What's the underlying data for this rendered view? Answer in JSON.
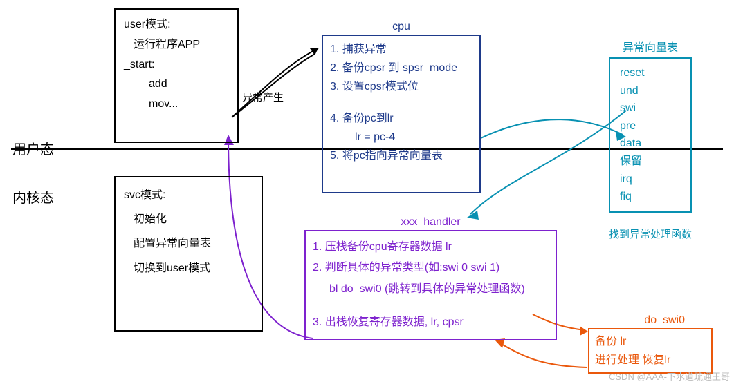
{
  "labels": {
    "user_state": "用户态",
    "kernel_state": "内核态",
    "exception_gen": "异常产生"
  },
  "user_box": {
    "l1": "user模式:",
    "l2": "运行程序APP",
    "l3": "_start:",
    "l4": "add",
    "l5": "mov..."
  },
  "svc_box": {
    "l1": "svc模式:",
    "l2": "初始化",
    "l3": "配置异常向量表",
    "l4": "切换到user模式"
  },
  "cpu_box": {
    "title": "cpu",
    "l1": "1. 捕获异常",
    "l2": "2. 备份cpsr 到 spsr_mode",
    "l3": "3.   设置cpsr模式位",
    "l4": "4. 备份pc到lr",
    "l5": "lr = pc-4",
    "l6": "5. 将pc指向异常向量表"
  },
  "vector_box": {
    "title": "异常向量表",
    "items": [
      "reset",
      "und",
      "swi",
      "pre",
      "data",
      "保留",
      "irq",
      "fiq"
    ],
    "footer": "找到异常处理函数"
  },
  "handler_box": {
    "title": "xxx_handler",
    "l1": "1. 压栈备份cpu寄存器数据  lr",
    "l2": "2. 判断具体的异常类型(如:swi 0   swi 1)",
    "l3": "bl   do_swi0   (跳转到具体的异常处理函数)",
    "l4": "3. 出栈恢复寄存器数据, lr, cpsr"
  },
  "doswi_box": {
    "title": "do_swi0",
    "l1": "备份  lr",
    "l2": "进行处理   恢复lr"
  },
  "watermark": "CSDN @AAA-下水道疏通王哥"
}
